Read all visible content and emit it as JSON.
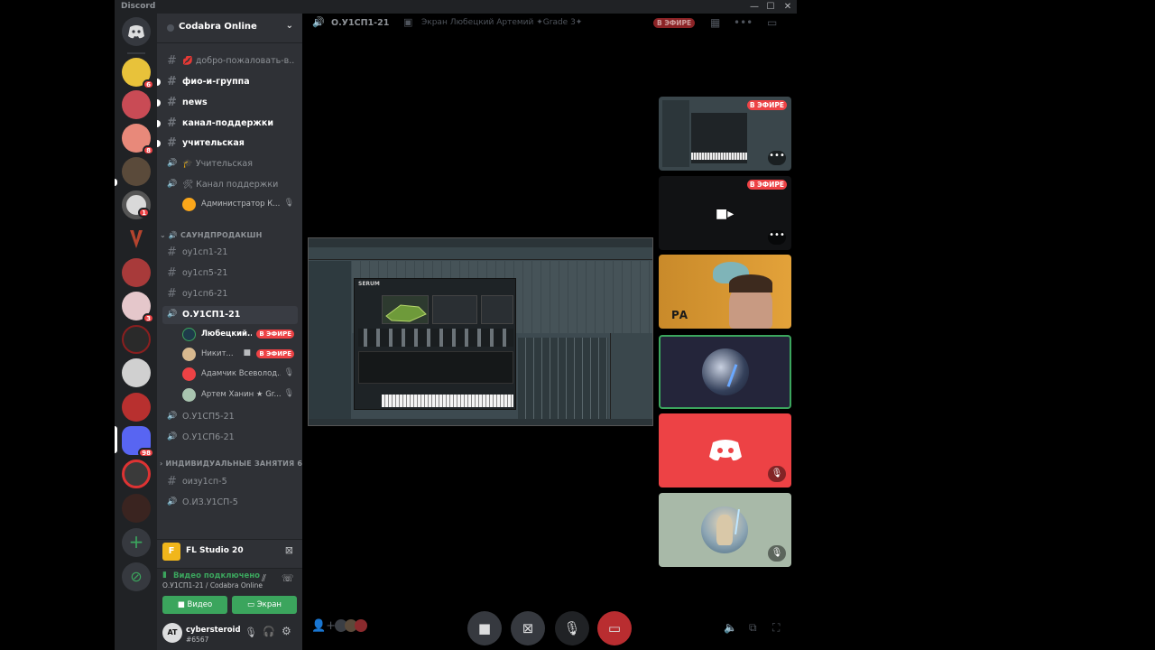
{
  "window": {
    "app_title": "Discord",
    "minimize_glyph": "—",
    "maximize_glyph": "☐",
    "close_glyph": "✕"
  },
  "guild_list": {
    "home_icon": "discord-home-icon",
    "badges": [
      "6",
      "8",
      "8",
      "1",
      "3",
      "98"
    ],
    "add_glyph": "+",
    "explore_glyph": "⊘"
  },
  "server": {
    "name": "Codabra Online",
    "chevron": "⌄"
  },
  "channels": [
    {
      "icon": "#",
      "label": "💋 добро-пожаловать-в..."
    },
    {
      "icon": "#",
      "label": "фио-и-группа"
    },
    {
      "icon": "#",
      "label": "news"
    },
    {
      "icon": "#",
      "label": "канал-поддержки"
    },
    {
      "icon": "#",
      "label": "учительская"
    },
    {
      "icon": "🔊",
      "label": "🎓 Учительская"
    },
    {
      "icon": "🔊",
      "label": "🛠 Канал поддержки"
    }
  ],
  "support_user": {
    "name": "Администратор К...",
    "mute": "🎙"
  },
  "category_sound": "САУНДПРОДАКШН",
  "sound_channels": [
    {
      "icon": "#",
      "label": "оу1сп1-21"
    },
    {
      "icon": "#",
      "label": "оу1сп5-21"
    },
    {
      "icon": "#",
      "label": "оу1сп6-21"
    },
    {
      "icon": "🔊",
      "label": "О.У1СП1-21"
    }
  ],
  "voice_users": [
    {
      "name": "Любецкий...",
      "live": "В ЭФИРЕ",
      "color": "#1e3a4a"
    },
    {
      "name": "Никит...",
      "live": "В ЭФИРЕ",
      "cam": "■",
      "color": "#d8b98f"
    },
    {
      "name": "Адамчик Всеволод...",
      "mute": "🎙",
      "color": "#ed4245"
    },
    {
      "name": "Артем Ханин ★ Gr...",
      "mute": "🎙",
      "color": "#a9c4b0"
    }
  ],
  "sound_voice_more": [
    {
      "icon": "🔊",
      "label": "О.У1СП5-21"
    },
    {
      "icon": "🔊",
      "label": "О.У1СП6-21"
    }
  ],
  "category_individual": "ИНДИВИДУАЛЬНЫЕ ЗАНЯТИЯ 6",
  "individual_channels": [
    {
      "icon": "#",
      "label": "оизу1сп-5"
    },
    {
      "icon": "🔊",
      "label": "О.ИЗ.У1СП-5"
    }
  ],
  "activity": {
    "game": "FL Studio 20",
    "logo": "F"
  },
  "voice_status": {
    "state": "Видео подключено",
    "location": "О.У1СП1-21 / Codabra Online",
    "video_button": "Видео",
    "screen_button": "Экран"
  },
  "user": {
    "name": "cybersteroid",
    "tag": "#6567",
    "avatar_text": "AT"
  },
  "topbar": {
    "channel": "О.У1СП1-21",
    "stream": "Экран Любецкий Артемий ✦Grade 3✦",
    "live": "В ЭФИРЕ"
  },
  "tiles": [
    {
      "kind": "screen",
      "live": "В ЭФИРЕ",
      "more": "•••"
    },
    {
      "kind": "camera-off",
      "live": "В ЭФИРЕ",
      "more": "•••"
    },
    {
      "kind": "webcam",
      "label": "РА"
    },
    {
      "kind": "avatar-speaking"
    },
    {
      "kind": "discord-logo",
      "mute": "🎙"
    },
    {
      "kind": "avatar",
      "mute": "🎙"
    }
  ],
  "colors": {
    "accent_green": "#3ba55d",
    "live_red": "#ed4245",
    "blurple": "#5865f2",
    "hangup": "#ed4245"
  }
}
